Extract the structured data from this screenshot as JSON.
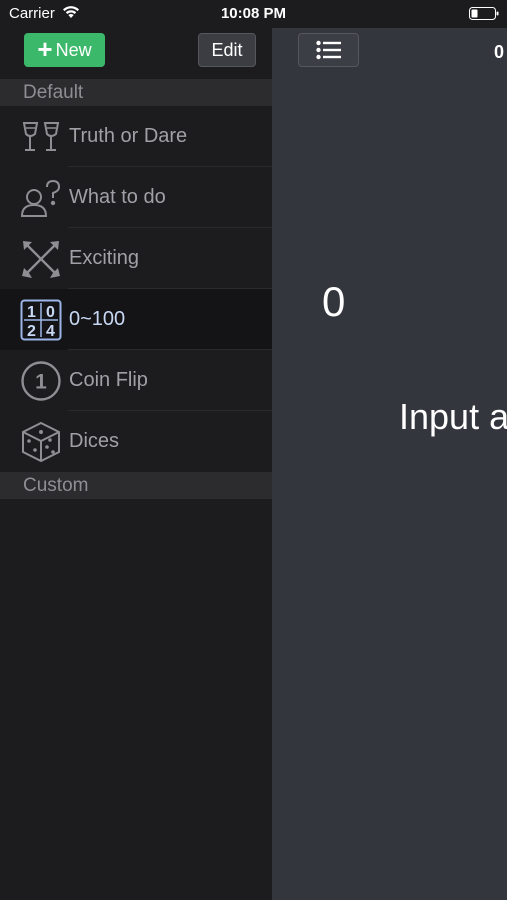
{
  "status_bar": {
    "carrier": "Carrier",
    "time": "10:08 PM"
  },
  "sidebar": {
    "new_label": "New",
    "edit_label": "Edit",
    "sections": {
      "default": "Default",
      "custom": "Custom"
    },
    "items": [
      {
        "label": "Truth or Dare",
        "icon": "wine-glasses-icon"
      },
      {
        "label": "What to do",
        "icon": "person-question-icon"
      },
      {
        "label": "Exciting",
        "icon": "crossed-arrows-icon"
      },
      {
        "label": "0~100",
        "icon": "number-grid-icon",
        "selected": true,
        "grid": [
          "1",
          "0",
          "2",
          "4"
        ]
      },
      {
        "label": "Coin Flip",
        "icon": "coin-icon",
        "coin": "1"
      },
      {
        "label": "Dices",
        "icon": "dice-icon"
      }
    ]
  },
  "main": {
    "top_counter": "0",
    "edge_text": "",
    "value": "0",
    "prompt": "Input a"
  }
}
